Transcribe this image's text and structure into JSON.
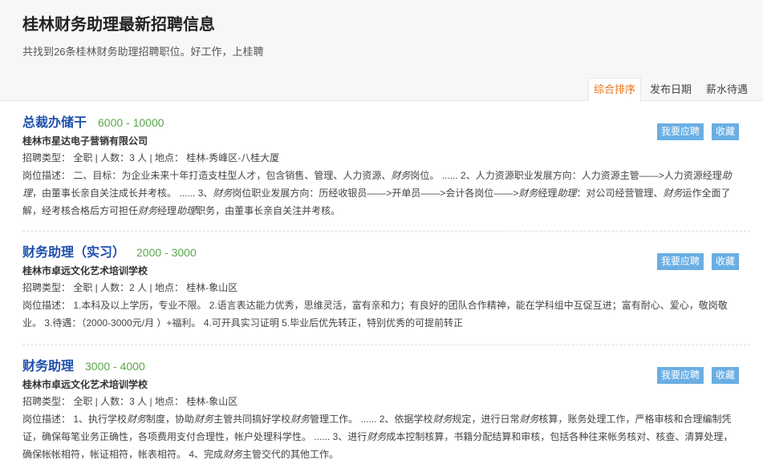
{
  "header": {
    "title": "桂林财务助理最新招聘信息",
    "subtitle": "共找到26条桂林财务助理招聘职位。好工作，上桂聘"
  },
  "sort_tabs": [
    {
      "label": "综合排序",
      "active": true
    },
    {
      "label": "发布日期",
      "active": false
    },
    {
      "label": "薪水待遇",
      "active": false
    }
  ],
  "actions": {
    "apply_label": "我要应聘",
    "favorite_label": "收藏"
  },
  "colors": {
    "accent": "#e8731a",
    "title": "#1f4fae",
    "salary": "#5aa64a",
    "button": "#6aaee3"
  },
  "jobs": [
    {
      "title": "总裁办储干",
      "salary": "6000 - 10000",
      "company": "桂林市星达电子营销有限公司",
      "meta": "招聘类型： 全职 | 人数：3 人 | 地点： 桂林-秀峰区-八桂大厦",
      "description_segments": [
        "岗位描述： 二、目标：为企业未来十年打造支柱型人才，包含销售、管理、人力资源、",
        "财务",
        "岗位。 ...... 2、人力资源职业发展方向：人力资源主管——>人力资源经理",
        "助理",
        "，由董事长亲自关注成长并考核。 ...... 3、",
        "财务",
        "岗位职业发展方向：历经收银员——>开单员——>会计各岗位——>",
        "财务",
        "经理",
        "助理",
        "：对公司经营管理、",
        "财务",
        "运作全面了解，经考核合格后方可担任",
        "财务",
        "经理",
        "助理",
        "职务，由董事长亲自关注并考核。"
      ]
    },
    {
      "title": "财务助理（实习）",
      "salary": "2000 - 3000",
      "company": "桂林市卓远文化艺术培训学校",
      "meta": "招聘类型： 全职 | 人数：2 人 | 地点： 桂林-象山区",
      "description_segments": [
        "岗位描述： 1.本科及以上学历，专业不限。 2.语言表达能力优秀，思维灵活，富有亲和力；有良好的团队合作精神，能在学科组中互促互进；富有耐心、爱心，敬岗敬业。 3.待遇：（2000-3000元/月 ）+福利。 4.可开具实习证明 5.毕业后优先转正，特别优秀的可提前转正"
      ]
    },
    {
      "title": "财务助理",
      "salary": "3000 - 4000",
      "company": "桂林市卓远文化艺术培训学校",
      "meta": "招聘类型： 全职 | 人数：3 人 | 地点： 桂林-象山区",
      "description_segments": [
        "岗位描述： 1、执行学校",
        "财务",
        "制度，协助",
        "财务",
        "主管共同搞好学校",
        "财务",
        "管理工作。 ...... 2、依据学校",
        "财务",
        "规定，进行日常",
        "财务",
        "核算，账务处理工作，严格审核和合理编制凭证，确保每笔业务正确性，各项费用支付合理性，帐户处理科学性。 ...... 3、进行",
        "财务",
        "成本控制核算，书籍分配结算和审核，包括各种往来帐务核对、核查、清算处理，确保帐帐相符，帐证相符，帐表相符。 4、完成",
        "财务",
        "主管交代的其他工作。"
      ]
    }
  ]
}
